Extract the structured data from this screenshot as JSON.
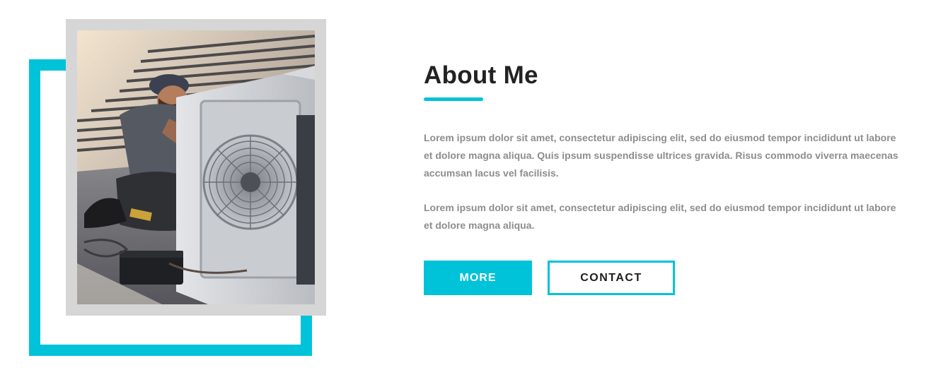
{
  "about": {
    "title": "About Me",
    "paragraph_1": "Lorem ipsum dolor sit amet, consectetur adipiscing elit, sed do eiusmod tempor incididunt ut labore et dolore magna aliqua. Quis ipsum suspendisse ultrices gravida. Risus commodo viverra maecenas accumsan lacus vel facilisis.",
    "paragraph_2": "Lorem ipsum dolor sit amet, consectetur adipiscing elit, sed do eiusmod tempor incididunt ut labore et dolore magna aliqua.",
    "more_label": "MORE",
    "contact_label": "CONTACT"
  },
  "colors": {
    "accent": "#00c2d8",
    "heading": "#222222",
    "body_text": "#8d8d8d",
    "photo_border": "#d6d6d6"
  }
}
